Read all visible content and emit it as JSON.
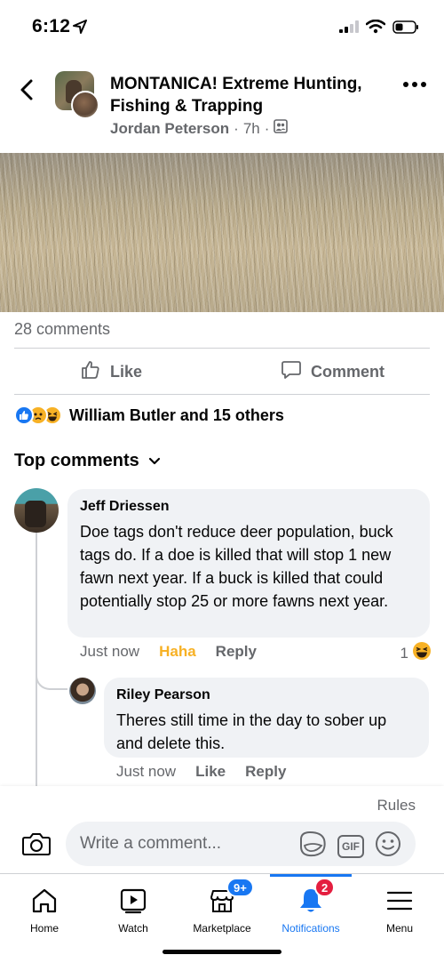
{
  "status_bar": {
    "time": "6:12"
  },
  "header": {
    "group_name": "MONTANICA! Extreme Hunting, Fishing & Trapping",
    "author": "Jordan Peterson",
    "time_ago": "7h",
    "separator": "·"
  },
  "post": {
    "comments_count": "28 comments"
  },
  "actions": {
    "like_label": "Like",
    "comment_label": "Comment"
  },
  "reactions": {
    "summary": "William Butler and 15 others"
  },
  "comments_section": {
    "sort_label": "Top comments"
  },
  "comments": [
    {
      "author": "Jeff Driessen",
      "text": "Doe tags don't reduce deer population, buck tags do. If a doe is killed that will stop 1 new fawn next year. If a buck is killed that could potentially stop 25 or more fawns next year.",
      "time": "Just now",
      "reaction_label": "Haha",
      "reply_label": "Reply",
      "reaction_count": "1"
    },
    {
      "author": "Riley Pearson",
      "text": "Theres still time in the day to sober up and delete this.",
      "time": "Just now",
      "like_label": "Like",
      "reply_label": "Reply"
    }
  ],
  "composer": {
    "rules_label": "Rules",
    "placeholder": "Write a comment...",
    "gif_label": "GIF"
  },
  "tab_bar": {
    "tabs": [
      {
        "label": "Home",
        "icon": "home-icon"
      },
      {
        "label": "Watch",
        "icon": "watch-icon"
      },
      {
        "label": "Marketplace",
        "icon": "marketplace-icon",
        "badge": "9+"
      },
      {
        "label": "Notifications",
        "icon": "bell-icon",
        "badge": "2",
        "active": true
      },
      {
        "label": "Menu",
        "icon": "menu-icon"
      }
    ]
  },
  "colors": {
    "accent": "#1877f2",
    "haha": "#f7b125",
    "badge_red": "#e41e3f",
    "secondary_text": "#65676b"
  }
}
